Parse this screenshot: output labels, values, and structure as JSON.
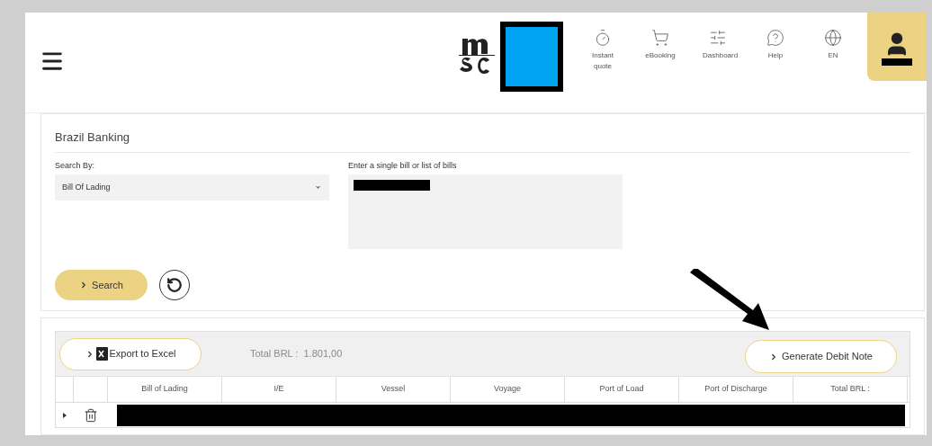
{
  "header": {
    "nav": [
      {
        "label": "Instant quote"
      },
      {
        "label": "eBooking"
      },
      {
        "label": "Dashboard"
      },
      {
        "label": "Help"
      },
      {
        "label": "EN"
      }
    ]
  },
  "search_card": {
    "title": "Brazil Banking",
    "search_by_label": "Search By:",
    "search_by_value": "Bill Of Lading",
    "bills_label": "Enter a single bill or list of bills",
    "search_button": "Search"
  },
  "results": {
    "export_button": "Export to Excel",
    "total": "Total BRL :  1.801,00",
    "generate_button": "Generate Debit Note",
    "columns": [
      "Bill of Lading",
      "I/E",
      "Vessel",
      "Voyage",
      "Port of Load",
      "Port of Discharge",
      "Total BRL :"
    ]
  }
}
